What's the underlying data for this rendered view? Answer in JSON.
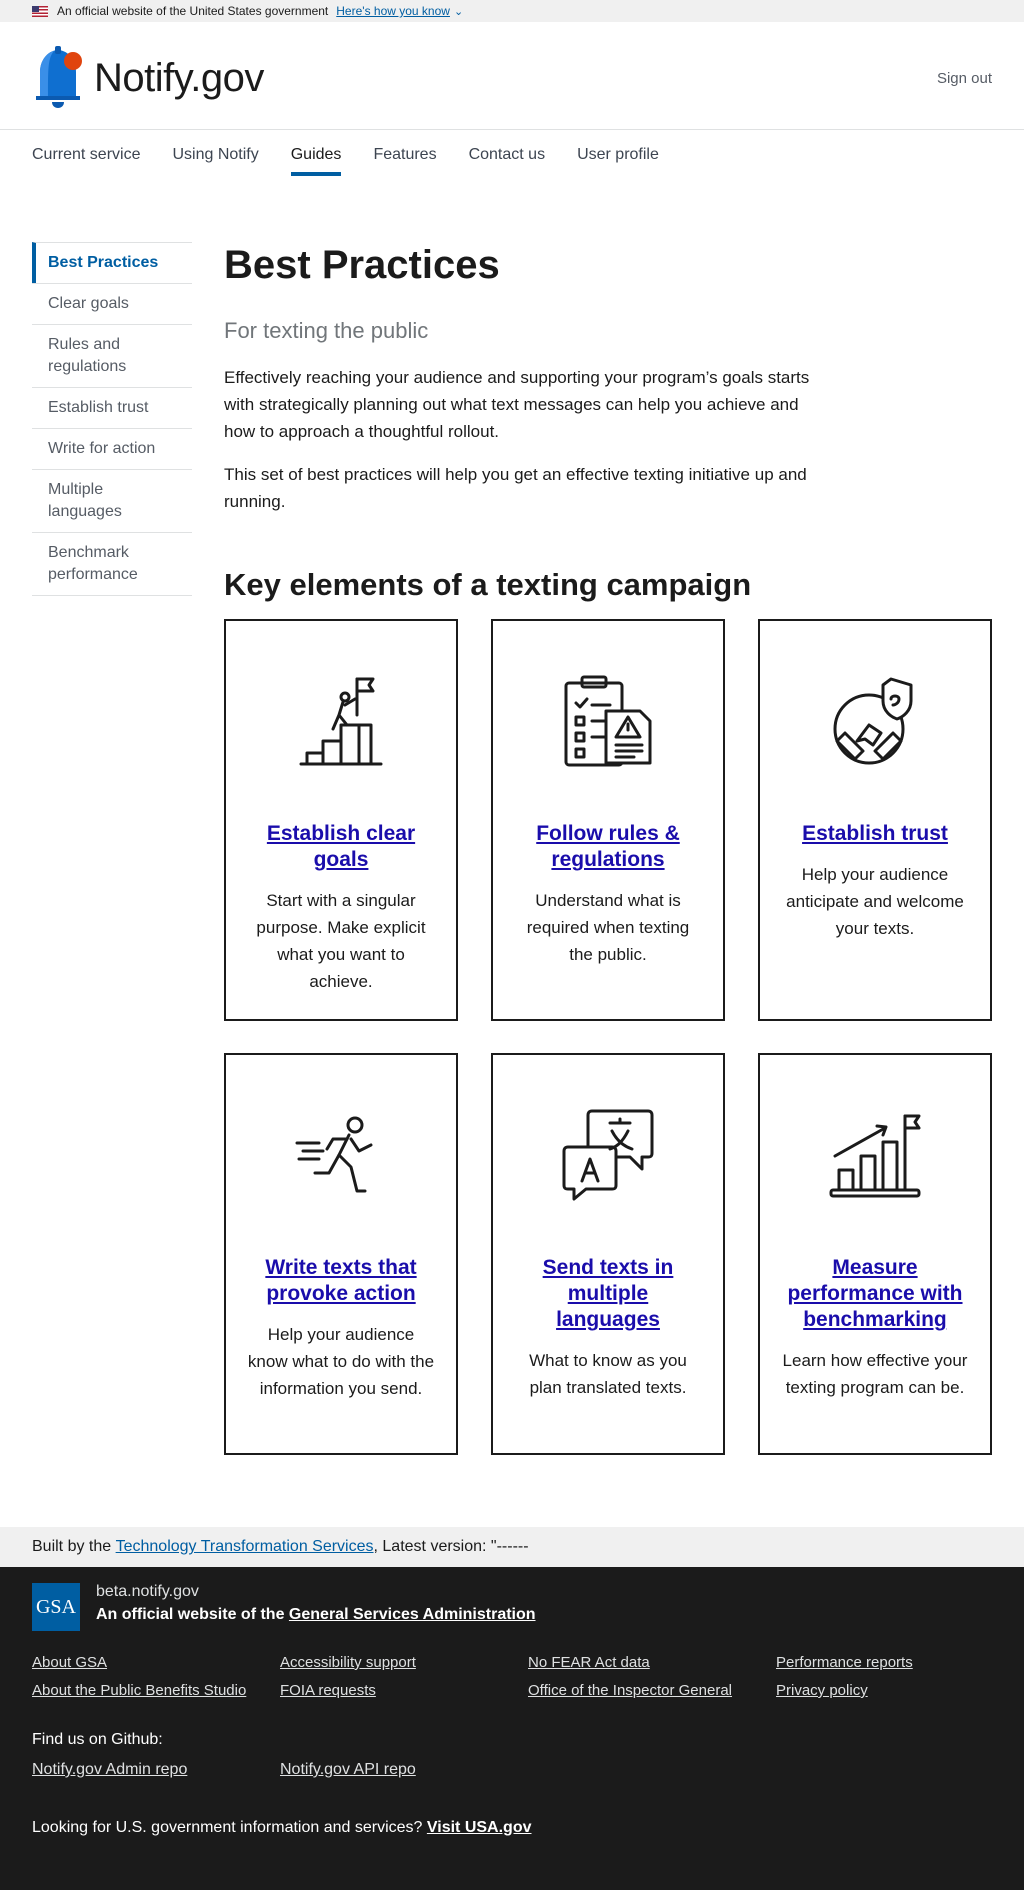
{
  "banner": {
    "text": "An official website of the United States government",
    "link": "Here's how you know"
  },
  "header": {
    "logo_text": "Notify.gov",
    "sign_out": "Sign out"
  },
  "nav": {
    "items": [
      "Current service",
      "Using Notify",
      "Guides",
      "Features",
      "Contact us",
      "User profile"
    ],
    "active": "Guides"
  },
  "sidenav": {
    "items": [
      "Best Practices",
      "Clear goals",
      "Rules and regulations",
      "Establish trust",
      "Write for action",
      "Multiple languages",
      "Benchmark performance"
    ]
  },
  "main": {
    "title": "Best Practices",
    "subtitle": "For texting the public",
    "paragraphs": [
      "Effectively reaching your audience and supporting your program’s goals starts with strategically planning out what text messages can help you achieve and how to approach a thoughtful rollout.",
      "This set of best practices will help you get an effective texting initiative up and running."
    ],
    "section_title": "Key elements of a texting campaign",
    "cards": [
      {
        "icon": "mountain-flag-icon",
        "title": "Establish clear goals",
        "desc": "Start with a singular purpose. Make explicit what you want to achieve."
      },
      {
        "icon": "checklist-warning-icon",
        "title": "Follow rules & regulations",
        "desc": "Understand what is required when texting the public."
      },
      {
        "icon": "handshake-shield-icon",
        "title": "Establish trust",
        "desc": "Help your audience anticipate and welcome your texts."
      },
      {
        "icon": "running-person-icon",
        "title": "Write texts that provoke action",
        "desc": "Help your audience know what to do with the information you send."
      },
      {
        "icon": "translation-bubbles-icon",
        "title": "Send texts in multiple languages",
        "desc": "What to know as you plan translated texts."
      },
      {
        "icon": "bar-chart-flag-icon",
        "title": "Measure performance with benchmarking",
        "desc": "Learn how effective your texting program can be."
      }
    ]
  },
  "built_by": {
    "prefix": "Built by the",
    "link": "Technology Transformation Services",
    "suffix": ", Latest version: \"------"
  },
  "footer": {
    "logo_text": "GSA",
    "domain": "beta.notify.gov",
    "official_prefix": "An official website of the",
    "official_link": "General Services Administration",
    "links": [
      "About GSA",
      "Accessibility support",
      "No FEAR Act data",
      "Performance reports",
      "About the Public Benefits Studio",
      "FOIA requests",
      "Office of the Inspector General",
      "Privacy policy"
    ],
    "github_heading": "Find us on Github:",
    "github_links": [
      "Notify.gov Admin repo",
      "Notify.gov API repo"
    ],
    "looking_text": "Looking for U.S. government information and services?",
    "looking_link": "Visit USA.gov"
  },
  "colors": {
    "primary": "#005ea2",
    "brand_orange": "#e0440e",
    "link_card": "#1a0dab",
    "footer_bg": "#1b1b1b"
  }
}
